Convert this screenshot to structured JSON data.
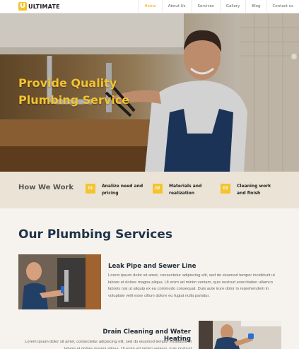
{
  "header": {
    "logo_mark": "U",
    "logo_text": "ULTIMATE",
    "nav": [
      "Home",
      "About Us",
      "Services",
      "Gallery",
      "Blog",
      "Contact us"
    ],
    "active_nav": "Home"
  },
  "hero": {
    "title": "Provide Quality Plumbing Service",
    "next_arrow": "›"
  },
  "how": {
    "title": "How We Work",
    "steps": [
      {
        "num": "01",
        "label": "Analize need and pricing"
      },
      {
        "num": "02",
        "label": "Materials and realization"
      },
      {
        "num": "03",
        "label": "Cleaning work and finish"
      }
    ]
  },
  "services": {
    "title": "Our Plumbing Services",
    "items": [
      {
        "heading": "Leak Pipe and Sewer Line",
        "text": "Lorem ipsum dolor sit amet, consectetur adipiscing elit, sed do eiusmod tempor incididunt ut labore et dolore magna aliqua. Ut enim ad minim veniam, quis nostrud exercitation ullamco laboris nisi ut aliquip ex ea commodo consequat. Duis aute irure dolor in reprehenderit in voluptate velit esse cillum dolore eu fugiat nulla pariatur."
      },
      {
        "heading": "Drain Cleaning and Water Heating",
        "text": "Lorem ipsum dolor sit amet, consectetur adipiscing elit, sed do eiusmod tempor incididunt ut labore et dolore magna aliqua. Ut enim ad minim veniam, quis nostrud"
      }
    ]
  },
  "colors": {
    "accent": "#f4c430",
    "active_nav": "#f4a300",
    "heading_dark": "#1f3349",
    "how_band": "#ebe4d6",
    "page_bg": "#f6f3ee"
  }
}
